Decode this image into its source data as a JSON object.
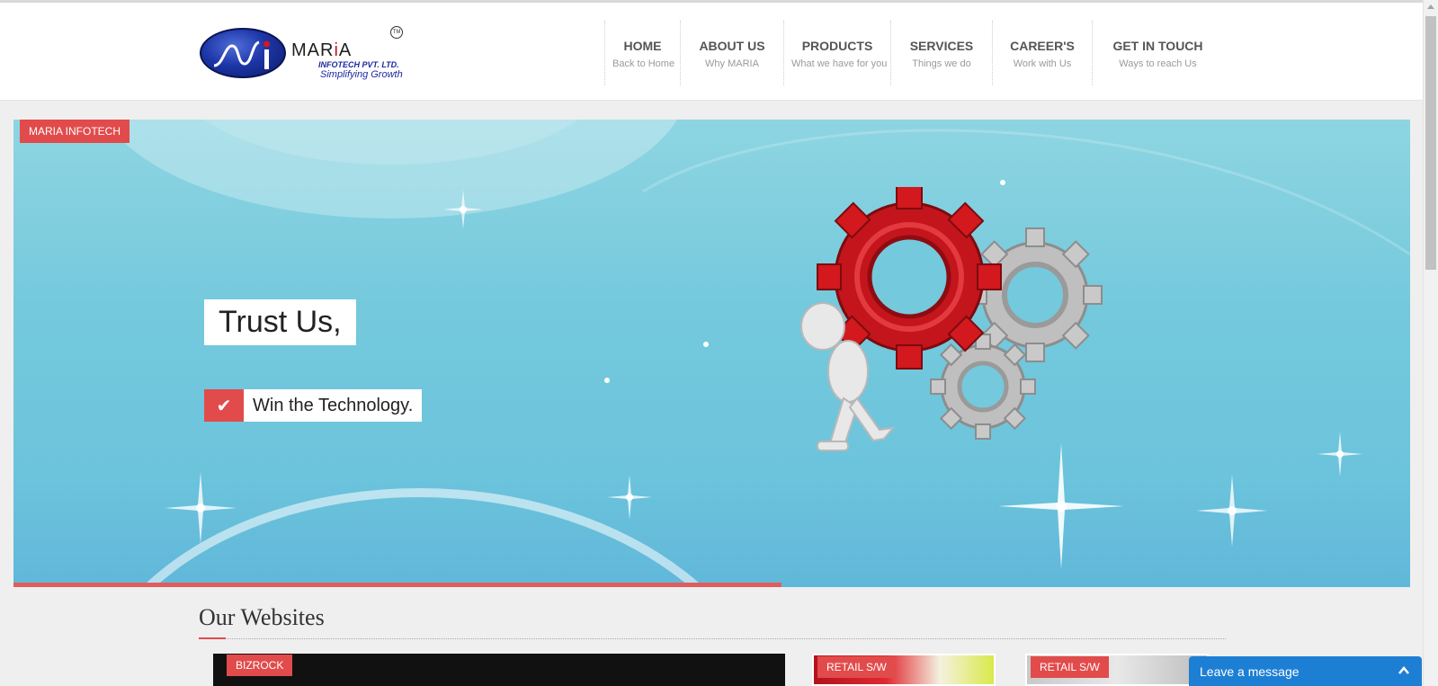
{
  "header": {
    "logo": {
      "name": "MARiA",
      "subtitle": "INFOTECH PVT. LTD.",
      "tagline": "Simplifying Growth",
      "trademark": "TM"
    },
    "nav": [
      {
        "title": "HOME",
        "subtitle": "Back to Home"
      },
      {
        "title": "ABOUT US",
        "subtitle": "Why MARIA"
      },
      {
        "title": "PRODUCTS",
        "subtitle": "What we have for you"
      },
      {
        "title": "SERVICES",
        "subtitle": "Things we do"
      },
      {
        "title": "CAREER'S",
        "subtitle": "Work with Us"
      },
      {
        "title": "GET IN TOUCH",
        "subtitle": "Ways to reach Us"
      }
    ]
  },
  "banner": {
    "badge": "MARIA INFOTECH",
    "headline": "Trust Us,",
    "subline": "Win the Technology.",
    "check_icon": "check-icon",
    "slide_progress": 0.55,
    "colors": {
      "accent": "#e24b4b",
      "sky": "#74c9dc",
      "gear_red": "#d3181e",
      "gear_silver": "#c9c9c9"
    }
  },
  "websites": {
    "title": "Our Websites",
    "cards": [
      {
        "badge": "BIZROCK"
      },
      {
        "badge": "RETAIL S/W"
      },
      {
        "badge": "RETAIL S/W"
      }
    ]
  },
  "chat": {
    "label": "Leave a message",
    "icon": "chevron-up-icon",
    "color": "#1d7fd4"
  }
}
